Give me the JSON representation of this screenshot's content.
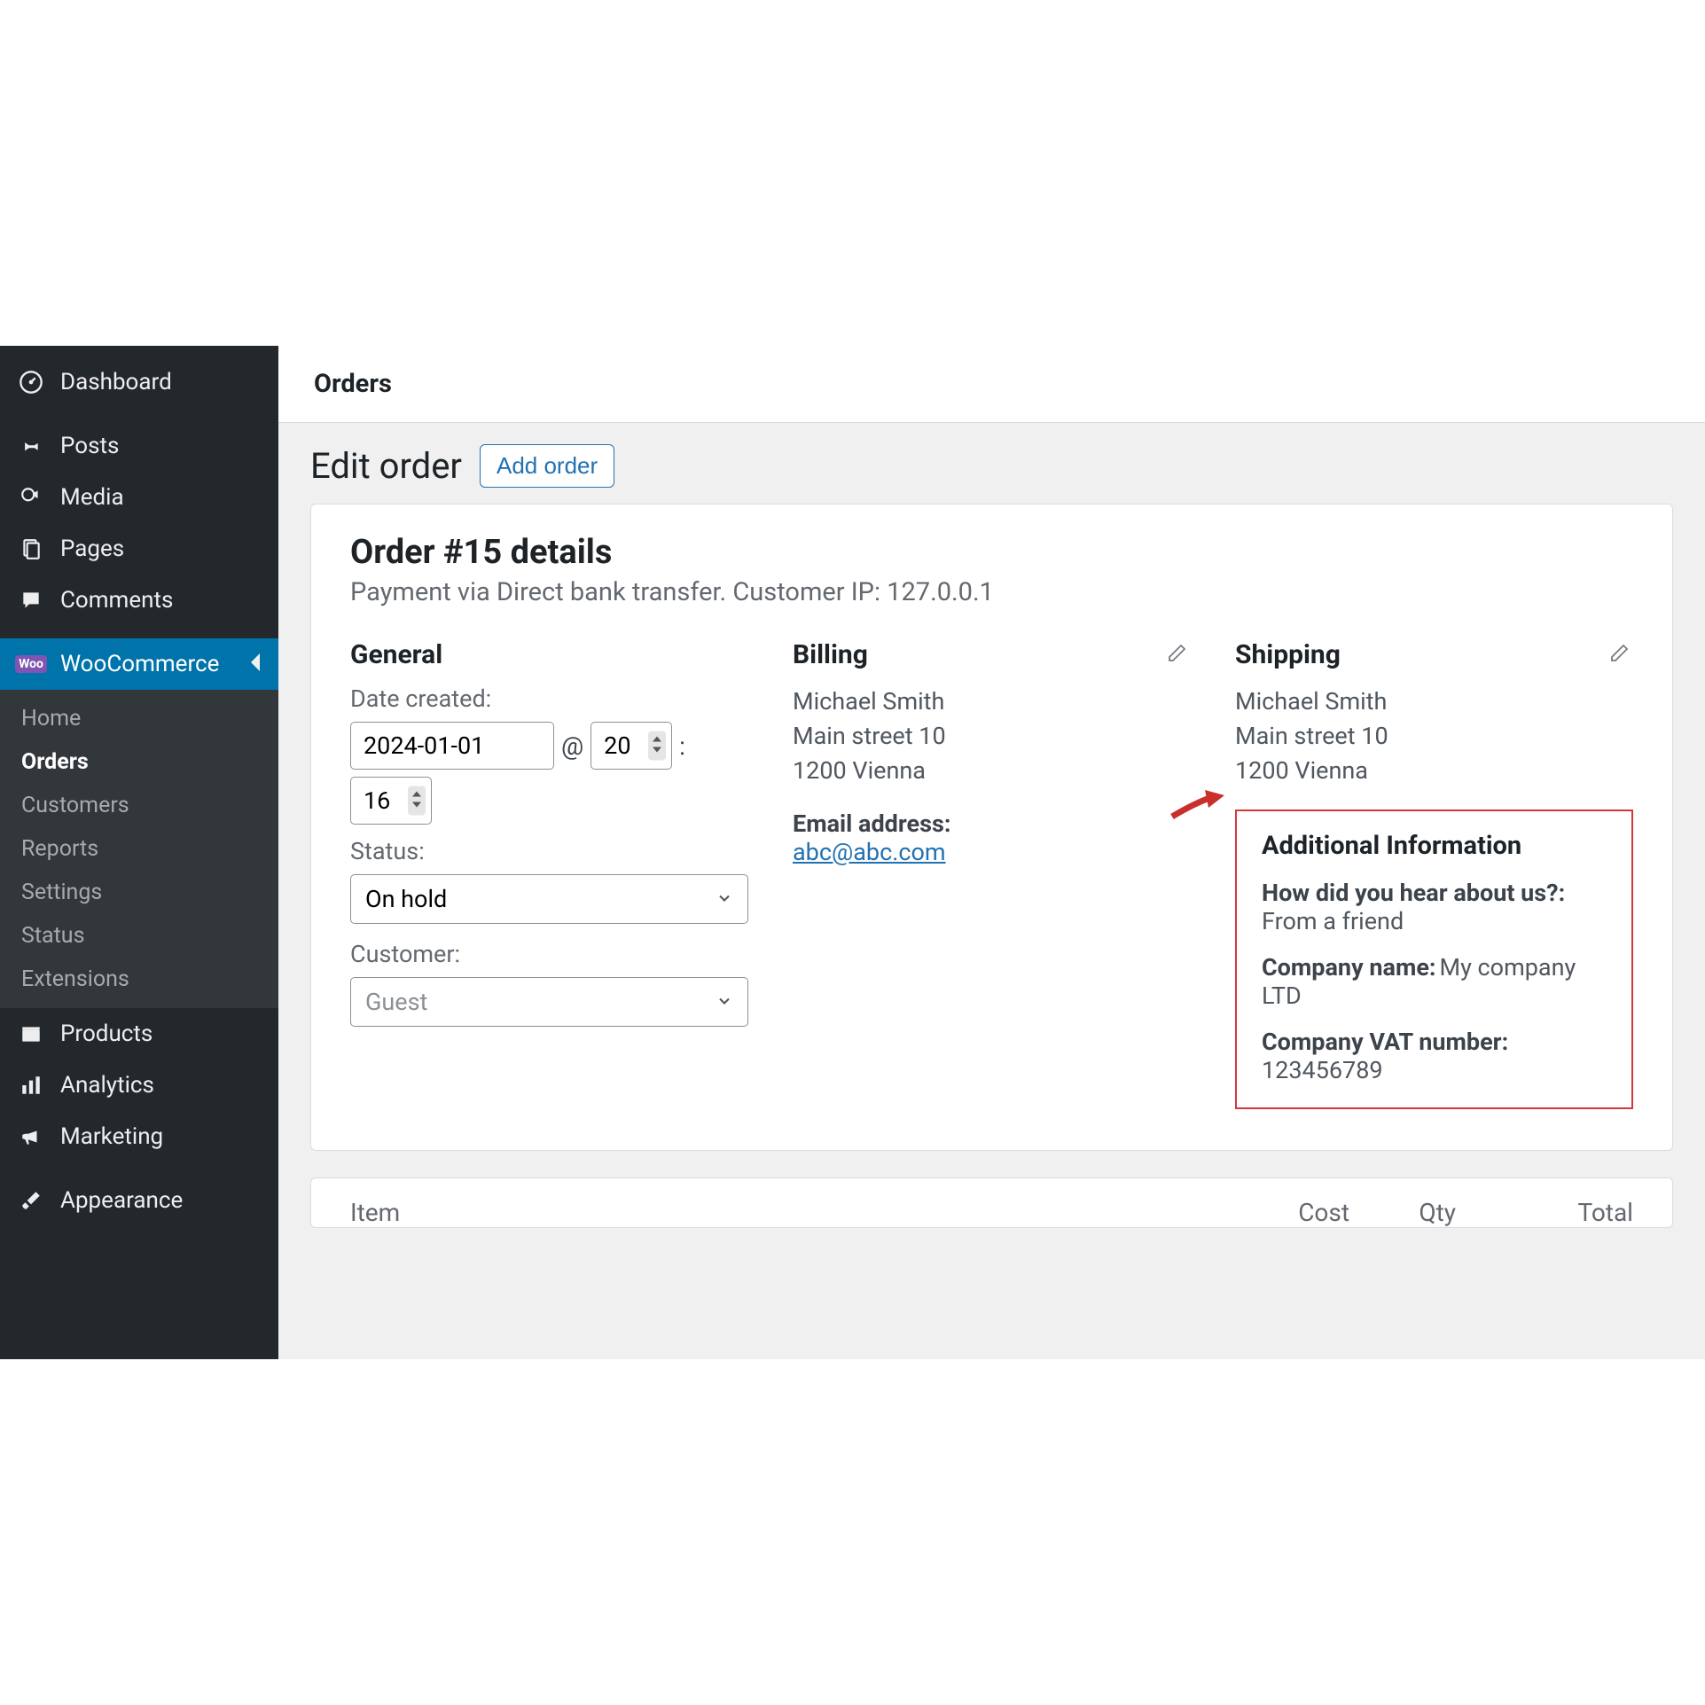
{
  "sidebar": {
    "items": [
      {
        "label": "Dashboard"
      },
      {
        "label": "Posts"
      },
      {
        "label": "Media"
      },
      {
        "label": "Pages"
      },
      {
        "label": "Comments"
      },
      {
        "label": "WooCommerce"
      },
      {
        "label": "Products"
      },
      {
        "label": "Analytics"
      },
      {
        "label": "Marketing"
      },
      {
        "label": "Appearance"
      }
    ],
    "woo_badge": "Woo",
    "sub": [
      {
        "label": "Home"
      },
      {
        "label": "Orders"
      },
      {
        "label": "Customers"
      },
      {
        "label": "Reports"
      },
      {
        "label": "Settings"
      },
      {
        "label": "Status"
      },
      {
        "label": "Extensions"
      }
    ]
  },
  "topbar": {
    "title": "Orders"
  },
  "page": {
    "heading": "Edit order",
    "add_btn": "Add order"
  },
  "order": {
    "title": "Order #15 details",
    "subtitle": "Payment via Direct bank transfer. Customer IP: 127.0.0.1"
  },
  "general": {
    "heading": "General",
    "date_label": "Date created:",
    "date_value": "2024-01-01",
    "hour_value": "20",
    "minute_value": "16",
    "status_label": "Status:",
    "status_value": "On hold",
    "customer_label": "Customer:",
    "customer_value": "Guest"
  },
  "billing": {
    "heading": "Billing",
    "name": "Michael Smith",
    "addr1": "Main street 10",
    "addr2": "1200 Vienna",
    "email_label": "Email address:",
    "email_value": "abc@abc.com"
  },
  "shipping": {
    "heading": "Shipping",
    "name": "Michael Smith",
    "addr1": "Main street 10",
    "addr2": "1200 Vienna"
  },
  "additional": {
    "heading": "Additional Information",
    "q1_label": "How did you hear about us?:",
    "q1_value": "From a friend",
    "q2_label": "Company name:",
    "q2_value": "My company LTD",
    "q3_label": "Company VAT number:",
    "q3_value": "123456789"
  },
  "items_table": {
    "c1": "Item",
    "c2": "Cost",
    "c3": "Qty",
    "c4": "Total"
  }
}
